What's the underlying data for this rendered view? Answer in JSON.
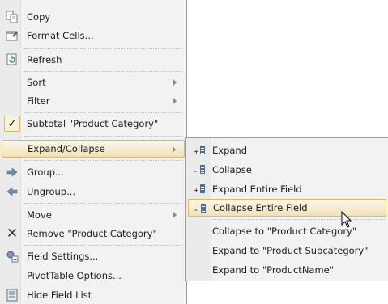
{
  "main_menu": {
    "copy": "Copy",
    "format_cells": "Format Cells...",
    "refresh": "Refresh",
    "sort": "Sort",
    "filter": "Filter",
    "subtotal": "Subtotal \"Product Category\"",
    "expand_collapse": "Expand/Collapse",
    "group": "Group...",
    "ungroup": "Ungroup...",
    "move": "Move",
    "remove": "Remove \"Product Category\"",
    "field_settings": "Field Settings...",
    "pivottable_options": "PivotTable Options...",
    "hide_field_list": "Hide Field List"
  },
  "sub_menu": {
    "expand": "Expand",
    "collapse": "Collapse",
    "expand_entire_field": "Expand Entire Field",
    "collapse_entire_field": "Collapse Entire Field",
    "collapse_to_product_category": "Collapse to \"Product Category\"",
    "expand_to_product_subcategory": "Expand to \"Product Subcategory\"",
    "expand_to_productname": "Expand to \"ProductName\""
  },
  "icons": {
    "copy": "copy-icon",
    "format_cells": "format-cells-icon",
    "refresh": "refresh-icon",
    "subtotal_check": "checkmark-icon",
    "group": "group-arrow-icon",
    "ungroup": "ungroup-arrow-icon",
    "remove": "remove-x-icon",
    "field_settings": "field-settings-icon",
    "hide_field_list": "field-list-icon"
  },
  "colors": {
    "highlight_border": "#d6b867",
    "menu_background": "#f2f2f2"
  }
}
